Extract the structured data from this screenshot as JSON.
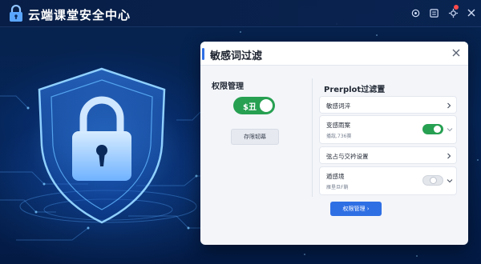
{
  "app": {
    "title": "云端课堂安全中心",
    "icon": "lock-icon"
  },
  "titlebar": {
    "icons": [
      "settings-icon",
      "document-icon",
      "gear-icon",
      "close-icon"
    ],
    "notification_dot_color": "#ff4b4b"
  },
  "hero": {
    "graphic": "shield-lock-icon",
    "colors": {
      "glow": "#4aa8ff",
      "background": "#052558"
    }
  },
  "dialog": {
    "title": "敏感词过滤",
    "left": {
      "heading": "权限管理",
      "toggle_label": "$丑",
      "toggle_on": true,
      "button_label": "存限韧幕"
    },
    "right": {
      "heading": "Prerplot过滤置",
      "rows": [
        {
          "label": "敏感词淬",
          "sub": "",
          "has_toggle": false
        },
        {
          "label": "变感雨案",
          "sub": "播敌,736赛",
          "has_toggle": true,
          "toggle_on": true
        },
        {
          "label": "弦占与交衿设置",
          "sub": "",
          "has_toggle": false
        },
        {
          "label": "遁感境",
          "sub": "雁垦旦F鞘",
          "has_toggle": true,
          "toggle_on": false
        }
      ],
      "primary_button": "权限管理 ›"
    }
  },
  "colors": {
    "accent_blue": "#2f6fe4",
    "toggle_green": "#27a052",
    "dialog_bg": "#f3f5f9"
  }
}
